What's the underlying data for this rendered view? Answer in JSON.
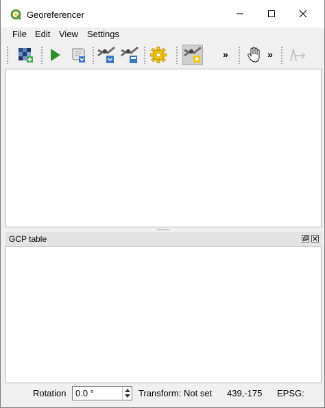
{
  "window": {
    "title": "Georeferencer"
  },
  "menu": {
    "items": [
      "File",
      "Edit",
      "View",
      "Settings"
    ]
  },
  "toolbar": {
    "open_raster": "open-raster-icon",
    "start": "start-georeferencing-icon",
    "generate_script": "generate-gdal-script-icon",
    "load_gcp": "load-gcp-points-icon",
    "save_gcp": "save-gcp-points-icon",
    "settings": "transformation-settings-icon",
    "add_point": "add-point-icon",
    "overflow_1": "»",
    "pan": "pan-icon",
    "overflow_2": "»",
    "link": "link-georeferencer-to-qgis-icon"
  },
  "dock": {
    "title": "GCP table"
  },
  "status": {
    "rotation_label": "Rotation",
    "rotation_value": "0.0 °",
    "transform": "Transform: Not set",
    "coordinates": "439,-175",
    "epsg": "EPSG:"
  },
  "colors": {
    "qgis_green": "#589632",
    "gear_yellow": "#f5c400",
    "run_green": "#2e8b2e"
  }
}
